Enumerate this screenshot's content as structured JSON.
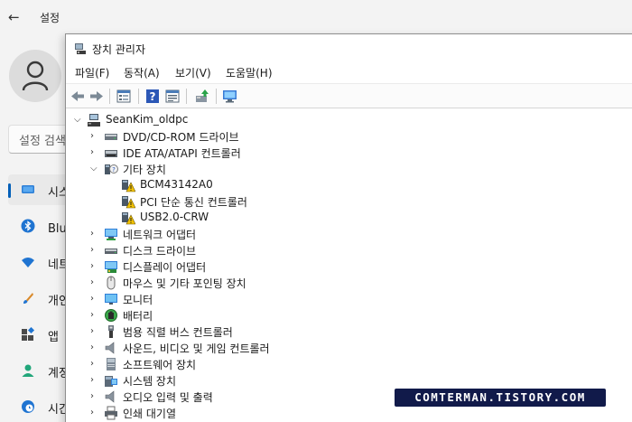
{
  "settings": {
    "title": "설정",
    "search_placeholder": "설정 검색",
    "nav": [
      {
        "label": "시스템",
        "icon": "monitor-icon"
      },
      {
        "label": "Bluetooth 및 장치",
        "icon": "bluetooth-icon"
      },
      {
        "label": "네트워크 및 인터넷",
        "icon": "wifi-icon"
      },
      {
        "label": "개인 설정",
        "icon": "brush-icon"
      },
      {
        "label": "앱",
        "icon": "apps-icon"
      },
      {
        "label": "계정",
        "icon": "account-icon"
      },
      {
        "label": "시간 및 언어",
        "icon": "clock-globe-icon"
      }
    ]
  },
  "device_manager": {
    "title": "장치 관리자",
    "menu": [
      "파일(F)",
      "동작(A)",
      "보기(V)",
      "도움말(H)"
    ],
    "toolbar": [
      "back-icon",
      "forward-icon",
      "properties-icon",
      "help-icon",
      "view-icon",
      "update-driver-icon",
      "monitor-scan-icon"
    ],
    "root": "SeanKim_oldpc",
    "categories": [
      {
        "label": "DVD/CD-ROM 드라이브",
        "expanded": false,
        "icon": "dvd-drive-icon"
      },
      {
        "label": "IDE ATA/ATAPI 컨트롤러",
        "expanded": false,
        "icon": "ide-controller-icon"
      },
      {
        "label": "기타 장치",
        "expanded": true,
        "icon": "other-devices-icon",
        "children": [
          {
            "label": "BCM43142A0",
            "icon": "warning-device-icon"
          },
          {
            "label": "PCI 단순 통신 컨트롤러",
            "icon": "warning-device-icon"
          },
          {
            "label": "USB2.0-CRW",
            "icon": "warning-device-icon"
          }
        ]
      },
      {
        "label": "네트워크 어댑터",
        "expanded": false,
        "icon": "network-adapter-icon"
      },
      {
        "label": "디스크 드라이브",
        "expanded": false,
        "icon": "disk-drive-icon"
      },
      {
        "label": "디스플레이 어댑터",
        "expanded": false,
        "icon": "display-adapter-icon"
      },
      {
        "label": "마우스 및 기타 포인팅 장치",
        "expanded": false,
        "icon": "mouse-icon"
      },
      {
        "label": "모니터",
        "expanded": false,
        "icon": "monitor-icon"
      },
      {
        "label": "배터리",
        "expanded": false,
        "icon": "battery-icon"
      },
      {
        "label": "범용 직렬 버스 컨트롤러",
        "expanded": false,
        "icon": "usb-icon"
      },
      {
        "label": "사운드, 비디오 및 게임 컨트롤러",
        "expanded": false,
        "icon": "speaker-icon"
      },
      {
        "label": "소프트웨어 장치",
        "expanded": false,
        "icon": "software-device-icon"
      },
      {
        "label": "시스템 장치",
        "expanded": false,
        "icon": "system-device-icon"
      },
      {
        "label": "오디오 입력 및 출력",
        "expanded": false,
        "icon": "audio-io-icon"
      },
      {
        "label": "인쇄 대기열",
        "expanded": false,
        "icon": "printer-icon"
      }
    ]
  },
  "watermark": "COMTERMAN.TISTORY.COM",
  "colors": {
    "accent": "#005fb8",
    "warning": "#f2c200",
    "watermark_bg": "#111a4a"
  }
}
